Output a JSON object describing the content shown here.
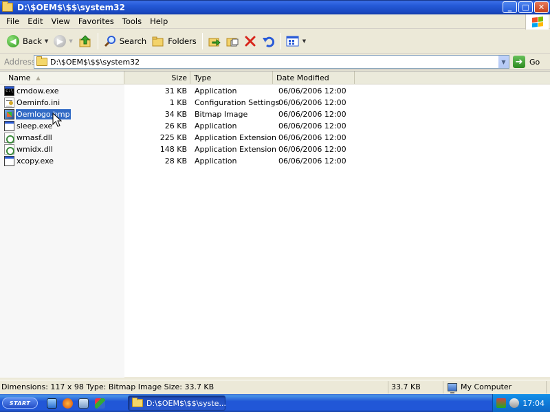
{
  "window": {
    "title": "D:\\$OEM$\\$$\\system32",
    "minimize_label": "_",
    "maximize_label": "□",
    "close_label": "✕"
  },
  "menu": {
    "file": "File",
    "edit": "Edit",
    "view": "View",
    "favorites": "Favorites",
    "tools": "Tools",
    "help": "Help"
  },
  "toolbar": {
    "back_label": "Back",
    "search_label": "Search",
    "folders_label": "Folders"
  },
  "address": {
    "label": "Address",
    "path": "D:\\$OEM$\\$$\\system32",
    "go_label": "Go"
  },
  "columns": {
    "name": "Name",
    "size": "Size",
    "type": "Type",
    "date": "Date Modified"
  },
  "files": [
    {
      "name": "cmdow.exe",
      "size": "31 KB",
      "type": "Application",
      "date": "06/06/2006 12:00",
      "icon": "cmd"
    },
    {
      "name": "Oeminfo.ini",
      "size": "1 KB",
      "type": "Configuration Settings",
      "date": "06/06/2006 12:00",
      "icon": "ini"
    },
    {
      "name": "Oemlogo.bmp",
      "size": "34 KB",
      "type": "Bitmap Image",
      "date": "06/06/2006 12:00",
      "icon": "bmp"
    },
    {
      "name": "sleep.exe",
      "size": "26 KB",
      "type": "Application",
      "date": "06/06/2006 12:00",
      "icon": "app"
    },
    {
      "name": "wmasf.dll",
      "size": "225 KB",
      "type": "Application Extension",
      "date": "06/06/2006 12:00",
      "icon": "dll"
    },
    {
      "name": "wmidx.dll",
      "size": "148 KB",
      "type": "Application Extension",
      "date": "06/06/2006 12:00",
      "icon": "dll"
    },
    {
      "name": "xcopy.exe",
      "size": "28 KB",
      "type": "Application",
      "date": "06/06/2006 12:00",
      "icon": "app"
    }
  ],
  "selected_file": "Oemlogo.bmp",
  "status": {
    "details": "Dimensions: 117 x 98 Type: Bitmap Image Size: 33.7 KB",
    "size": "33.7 KB",
    "zone": "My Computer"
  },
  "taskbar": {
    "start_label": "START",
    "window_button": "D:\\$OEM$\\$$\\syste...",
    "clock": "17:04"
  },
  "colors": {
    "selection": "#316ac5",
    "titlebar": "#2459d6",
    "taskbar": "#2157d7"
  }
}
